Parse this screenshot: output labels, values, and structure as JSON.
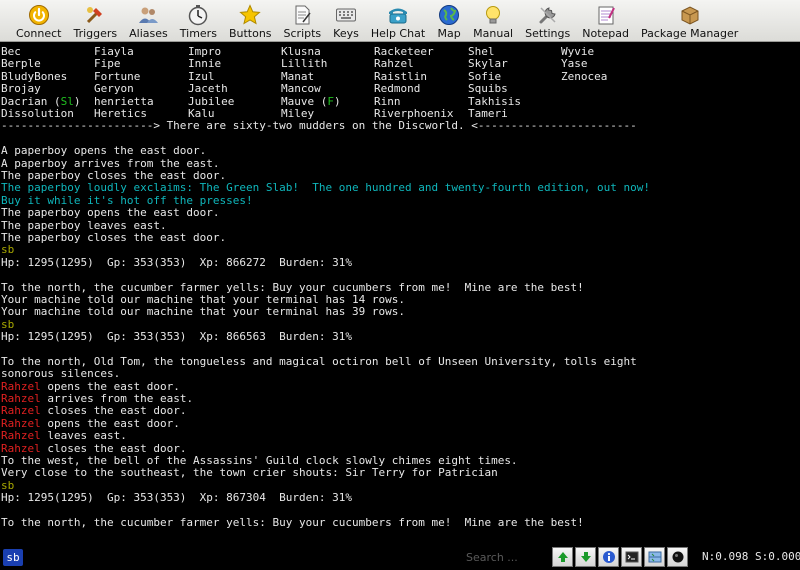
{
  "toolbar": {
    "buttons": [
      {
        "label": "Connect",
        "icon": "connect-power-icon"
      },
      {
        "label": "Triggers",
        "icon": "triggers-icon"
      },
      {
        "label": "Aliases",
        "icon": "aliases-people-icon"
      },
      {
        "label": "Timers",
        "icon": "timers-clock-icon"
      },
      {
        "label": "Buttons",
        "icon": "buttons-star-icon"
      },
      {
        "label": "Scripts",
        "icon": "scripts-document-icon"
      },
      {
        "label": "Keys",
        "icon": "keys-keyboard-icon"
      },
      {
        "label": "Help Chat",
        "icon": "help-chat-phone-icon"
      },
      {
        "label": "Map",
        "icon": "map-globe-icon"
      },
      {
        "label": "Manual",
        "icon": "manual-lightbulb-icon"
      },
      {
        "label": "Settings",
        "icon": "settings-wrench-icon"
      },
      {
        "label": "Notepad",
        "icon": "notepad-icon"
      },
      {
        "label": "Package Manager",
        "icon": "package-box-icon"
      }
    ]
  },
  "who_list": {
    "rows": [
      [
        "Bec",
        "Fiayla",
        "Impro",
        "Klusna",
        "Racketeer",
        "Shel",
        "Wyvie"
      ],
      [
        "Berple",
        "Fipe",
        "Innie",
        "Lillith",
        "Rahzel",
        "Skylar",
        "Yase"
      ],
      [
        "BludyBones",
        "Fortune",
        "Izul",
        "Manat",
        "Raistlin",
        "Sofie",
        "Zenocea"
      ],
      [
        "Brojay",
        "Geryon",
        "Jaceth",
        "Mancow",
        "Redmond",
        "Squibs",
        ""
      ],
      [
        "Dacrian (",
        "henrietta",
        "Jubilee",
        "Mauve (",
        "Rinn",
        "Takhisis",
        ""
      ],
      [
        "Dissolution",
        "Heretics",
        "Kalu",
        "Miley",
        "Riverphoenix",
        "Tameri",
        ""
      ]
    ],
    "dacrian_tag": "Sl",
    "mauve_tag": "F",
    "close_paren": ")",
    "summary": "-----------------------> There are sixty-two mudders on the Discworld. <------------------------"
  },
  "output": {
    "l01": "",
    "l02": "A paperboy opens the east door.",
    "l03": "A paperboy arrives from the east.",
    "l04": "The paperboy closes the east door.",
    "l05": "The paperboy loudly exclaims: The Green Slab!  The one hundred and twenty-fourth edition, out now!",
    "l06": "Buy it while it's hot off the presses!",
    "l07": "The paperboy opens the east door.",
    "l08": "The paperboy leaves east.",
    "l09": "The paperboy closes the east door.",
    "l10": "sb",
    "l11": "Hp: 1295(1295)  Gp: 353(353)  Xp: 866272  Burden: 31%",
    "l12": "",
    "l13": "To the north, the cucumber farmer yells: Buy your cucumbers from me!  Mine are the best!",
    "l14": "Your machine told our machine that your terminal has 14 rows.",
    "l15": "Your machine told our machine that your terminal has 39 rows.",
    "l16": "sb",
    "l17": "Hp: 1295(1295)  Gp: 353(353)  Xp: 866563  Burden: 31%",
    "l18": "",
    "l19": "To the north, Old Tom, the tongueless and magical octiron bell of Unseen University, tolls eight",
    "l20": "sonorous silences.",
    "rahzel": "Rahzel",
    "l21": " opens the east door.",
    "l22": " arrives from the east.",
    "l23": " closes the east door.",
    "l24": " opens the east door.",
    "l25": " leaves east.",
    "l26": " closes the east door.",
    "l27": "To the west, the bell of the Assassins' Guild clock slowly chimes eight times.",
    "l28": "Very close to the southeast, the town crier shouts: Sir Terry for Patrician",
    "l29": "sb",
    "l30": "Hp: 1295(1295)  Gp: 353(353)  Xp: 867304  Burden: 31%",
    "l31": "",
    "l32": "To the north, the cucumber farmer yells: Buy your cucumbers from me!  Mine are the best!"
  },
  "statusbar": {
    "profile_badge": "sb",
    "search_placeholder": "Search ...",
    "icons": [
      "scroll-up-icon",
      "scroll-down-icon",
      "info-icon",
      "command-line-icon",
      "split-screen-icon",
      "record-icon"
    ],
    "counters": "N:0.098 S:0.000"
  },
  "colors": {
    "background": "#000000",
    "text": "#e8e8e8",
    "cyan": "#0fb6bb",
    "prompt": "#a8a800",
    "player_red": "#e02020",
    "tag_green": "#20c020",
    "badge_blue": "#1a3fb0"
  }
}
